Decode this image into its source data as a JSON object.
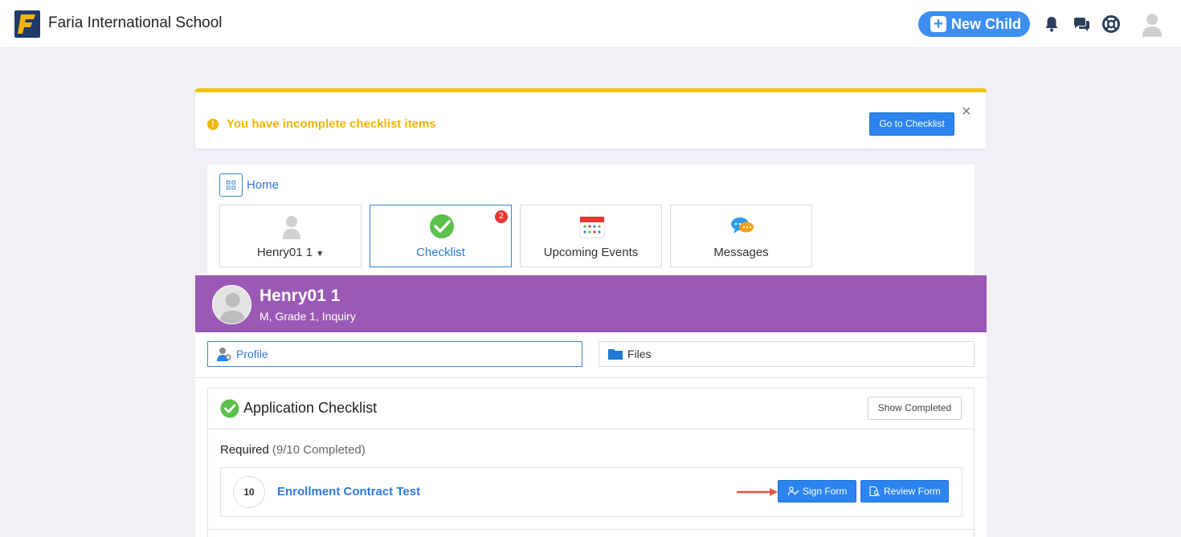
{
  "header": {
    "school_name": "Faria International School",
    "new_child_label": "New Child",
    "icons": [
      "bell-icon",
      "chat-icon",
      "help-lifebuoy-icon",
      "user-avatar-icon"
    ],
    "accent": "#3d8ef0"
  },
  "alert": {
    "message": "You have incomplete checklist items",
    "button_label": "Go to Checklist",
    "color": "#f2b400"
  },
  "home": {
    "link_label": "Home",
    "tiles": [
      {
        "label": "Henry01 1",
        "icon": "person-icon",
        "has_dropdown": true
      },
      {
        "label": "Checklist",
        "icon": "checkmark-circle-icon",
        "badge": "2",
        "active": true
      },
      {
        "label": "Upcoming Events",
        "icon": "calendar-icon"
      },
      {
        "label": "Messages",
        "icon": "chat-bubbles-icon"
      }
    ]
  },
  "profile": {
    "name": "Henry01 1",
    "details": "M, Grade 1, Inquiry",
    "band_color": "#9b59b6"
  },
  "tabs": [
    {
      "label": "Profile",
      "icon": "profile-user-icon",
      "active": true
    },
    {
      "label": "Files",
      "icon": "folder-icon"
    }
  ],
  "checklist": {
    "title": "Application Checklist",
    "show_completed_label": "Show Completed",
    "section_label": "Required",
    "section_count": "(9/10 Completed)",
    "items": [
      {
        "number": "10",
        "title": "Enrollment Contract Test",
        "sign_label": "Sign Form",
        "review_label": "Review Form"
      }
    ]
  }
}
